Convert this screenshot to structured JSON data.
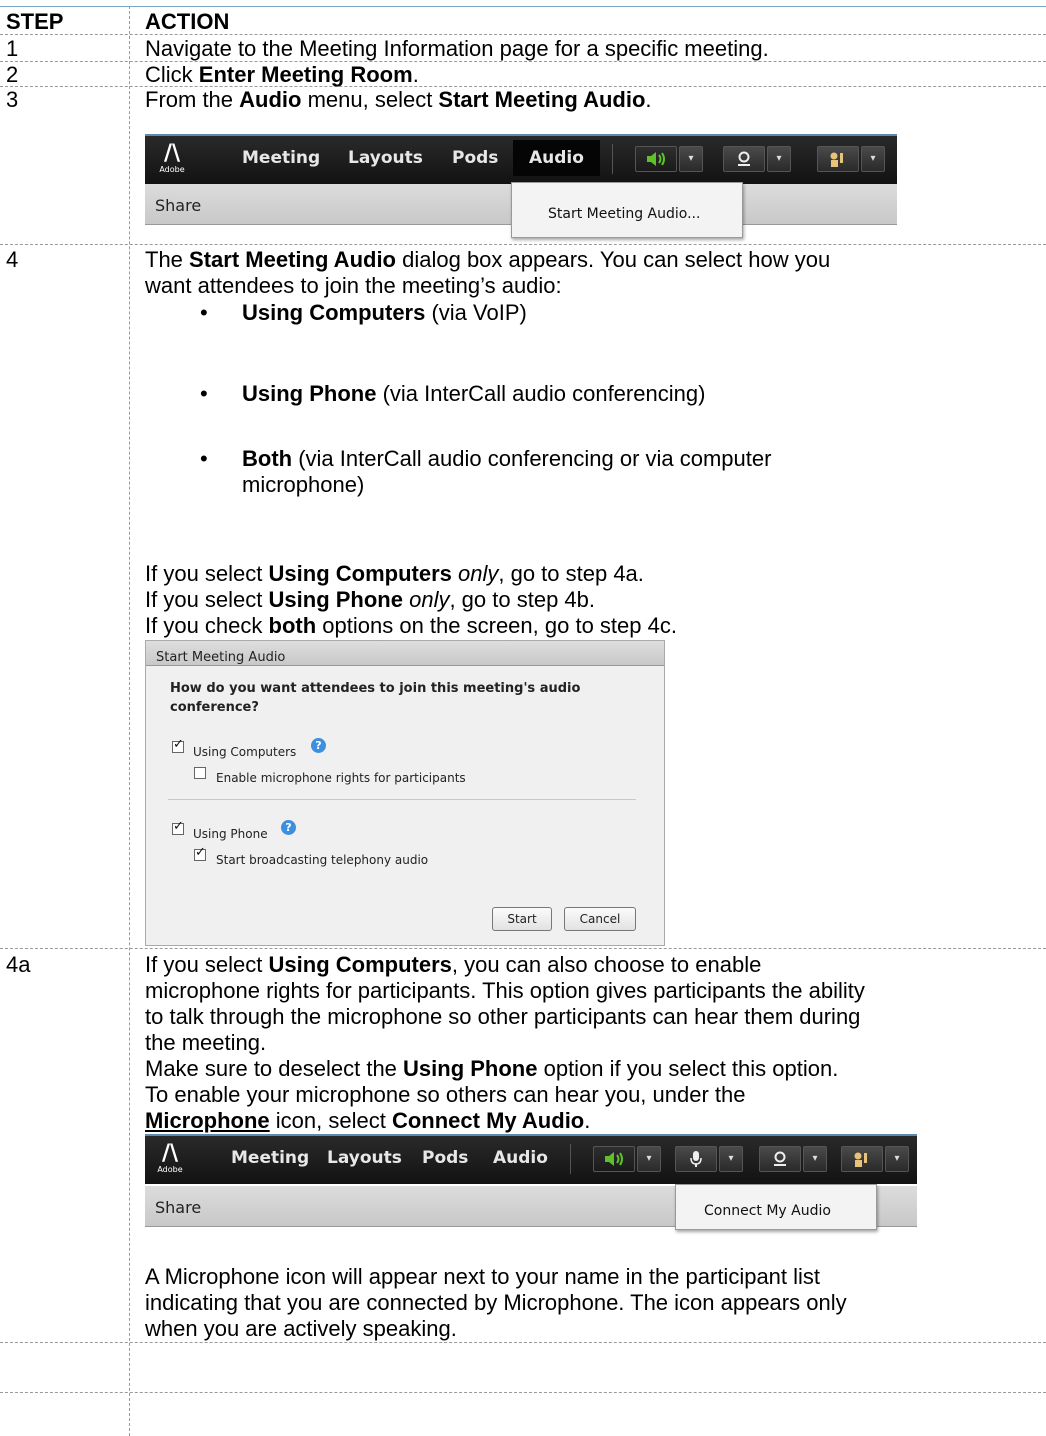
{
  "header": {
    "step": "STEP",
    "action": "ACTION"
  },
  "rows": {
    "r1": {
      "step": "1",
      "text": "Navigate to the Meeting Information page for a specific meeting."
    },
    "r2": {
      "step": "2",
      "pre": "Click ",
      "bold": "Enter Meeting Room",
      "post": "."
    },
    "r3": {
      "step": "3",
      "pre": "From the ",
      "bold1": "Audio",
      "mid": " menu, select ",
      "bold2": "Start Meeting Audio",
      "post": "."
    },
    "r4": {
      "step": "4",
      "intro_pre": "The ",
      "intro_bold": "Start Meeting Audio",
      "intro_post": " dialog box appears.  You can select how you",
      "intro_line2": "want attendees to join the meeting’s audio:",
      "bullets": [
        {
          "bold": "Using Computers",
          "text": " (via VoIP)"
        },
        {
          "bold": "Using Phone",
          "text": " (via InterCall audio conferencing)"
        },
        {
          "bold": "Both",
          "text": " (via InterCall audio conferencing or via computer",
          "line2": "microphone)"
        }
      ],
      "if1_pre": "If you select ",
      "if1_bold": "Using Computers",
      "if1_ital": "only",
      "if1_post": ", go to step 4a.",
      "if2_pre": "If you select ",
      "if2_bold": "Using Phone",
      "if2_ital": "only",
      "if2_post": ", go to step 4b.",
      "if3_pre": "If you check ",
      "if3_bold": "both",
      "if3_post": " options on the screen, go to step 4c."
    },
    "r4a": {
      "step": "4a",
      "p1_pre": "If you select ",
      "p1_bold": "Using Computers",
      "p1_post": ", you can also choose to enable",
      "p1_l2": "microphone rights for participants.  This option gives participants the ability",
      "p1_l3": "to talk through the microphone so other participants can hear them during",
      "p1_l4": "the meeting.",
      "p2_pre": "Make sure to deselect the ",
      "p2_bold": "Using Phone",
      "p2_post": " option if you select this option.",
      "p3_l1": "To enable your microphone so others can hear you, under the",
      "p3_bold1": "Microphone",
      "p3_mid": " icon, select ",
      "p3_bold2": "Connect My Audio",
      "p3_post": ".",
      "p4_l1": "A Microphone icon will appear next to your name in the participant list",
      "p4_l2": "indicating that you are connected by Microphone.  The icon appears only",
      "p4_l3": "when you are actively speaking."
    }
  },
  "toolbar": {
    "logo_text": "Adobe",
    "menus": [
      "Meeting",
      "Layouts",
      "Pods",
      "Audio"
    ],
    "share": "Share"
  },
  "dropdown1": {
    "item": "Start Meeting Audio..."
  },
  "dropdown2": {
    "item": "Connect My Audio"
  },
  "dialog": {
    "title": "Start Meeting Audio",
    "question": "How do you want attendees to join this meeting's audio conference?",
    "opt_computers": "Using Computers",
    "opt_computers_checked": true,
    "opt_mic_rights": "Enable microphone rights for participants",
    "opt_mic_rights_checked": false,
    "opt_phone": "Using Phone",
    "opt_phone_checked": true,
    "opt_broadcast": "Start broadcasting telephony audio",
    "opt_broadcast_checked": true,
    "start_label": "Start",
    "cancel_label": "Cancel"
  },
  "colors": {
    "green_speaker": "#5ec12a",
    "toolbar_dark": "#1a1a1a",
    "rule_blue": "#7aa7c8"
  }
}
